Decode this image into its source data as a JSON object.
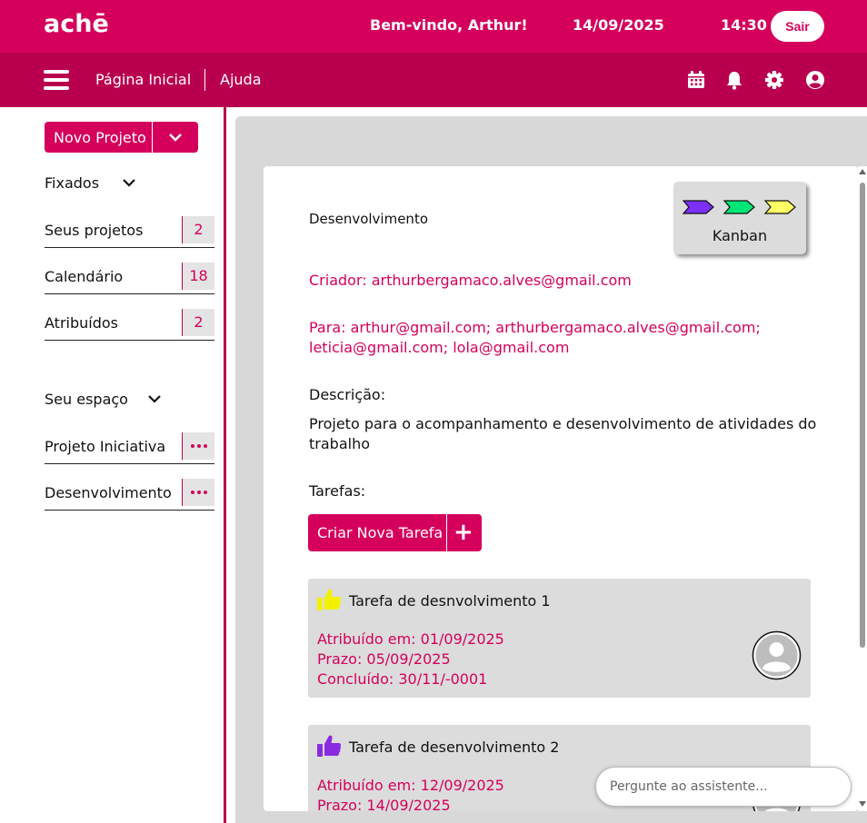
{
  "header": {
    "logo": "achē",
    "welcome": "Bem-vindo, Arthur!",
    "date": "14/09/2025",
    "time": "14:30",
    "logout_label": "Sair"
  },
  "nav": {
    "home_label": "Página Inicial",
    "help_label": "Ajuda",
    "icons": [
      "calendar-icon",
      "bell-icon",
      "gear-icon",
      "user-circle-icon"
    ]
  },
  "sidebar": {
    "new_project_label": "Novo Projeto",
    "pinned_title": "Fixados",
    "pinned_items": [
      {
        "label": "Seus projetos",
        "count": "2"
      },
      {
        "label": "Calendário",
        "count": "18"
      },
      {
        "label": "Atribuídos",
        "count": "2"
      }
    ],
    "space_title": "Seu espaço",
    "space_items": [
      {
        "label": "Projeto Iniciativa"
      },
      {
        "label": "Desenvolvimento"
      }
    ]
  },
  "project": {
    "title": "Desenvolvimento",
    "kanban_label": "Kanban",
    "creator": "Criador: arthurbergamaco.alves@gmail.com",
    "recipients": "Para: arthur@gmail.com; arthurbergamaco.alves@gmail.com; leticia@gmail.com; lola@gmail.com",
    "description_label": "Descrição:",
    "description": "Projeto para o acompanhamento e desenvolvimento de atividades do trabalho",
    "tasks_label": "Tarefas:",
    "new_task_label": "Criar Nova Tarefa",
    "tasks": [
      {
        "name": "Tarefa de desnvolvimento 1",
        "assigned": "Atribuído em: 01/09/2025",
        "deadline": "Prazo: 05/09/2025",
        "completed": "Concluído: 30/11/-0001",
        "thumb_color": "#f2f200"
      },
      {
        "name": "Tarefa de desenvolvimento 2",
        "assigned": "Atribuído em: 12/09/2025",
        "deadline": "Prazo: 14/09/2025",
        "completed": "",
        "thumb_color": "#8a2be2"
      }
    ]
  },
  "assistant": {
    "placeholder": "Pergunte ao assistente..."
  },
  "colors": {
    "brand": "#d5005c",
    "brand_dark": "#b8004f",
    "kanban_purple": "#7b2ff7",
    "kanban_green": "#00e676",
    "kanban_yellow": "#ffff66"
  }
}
